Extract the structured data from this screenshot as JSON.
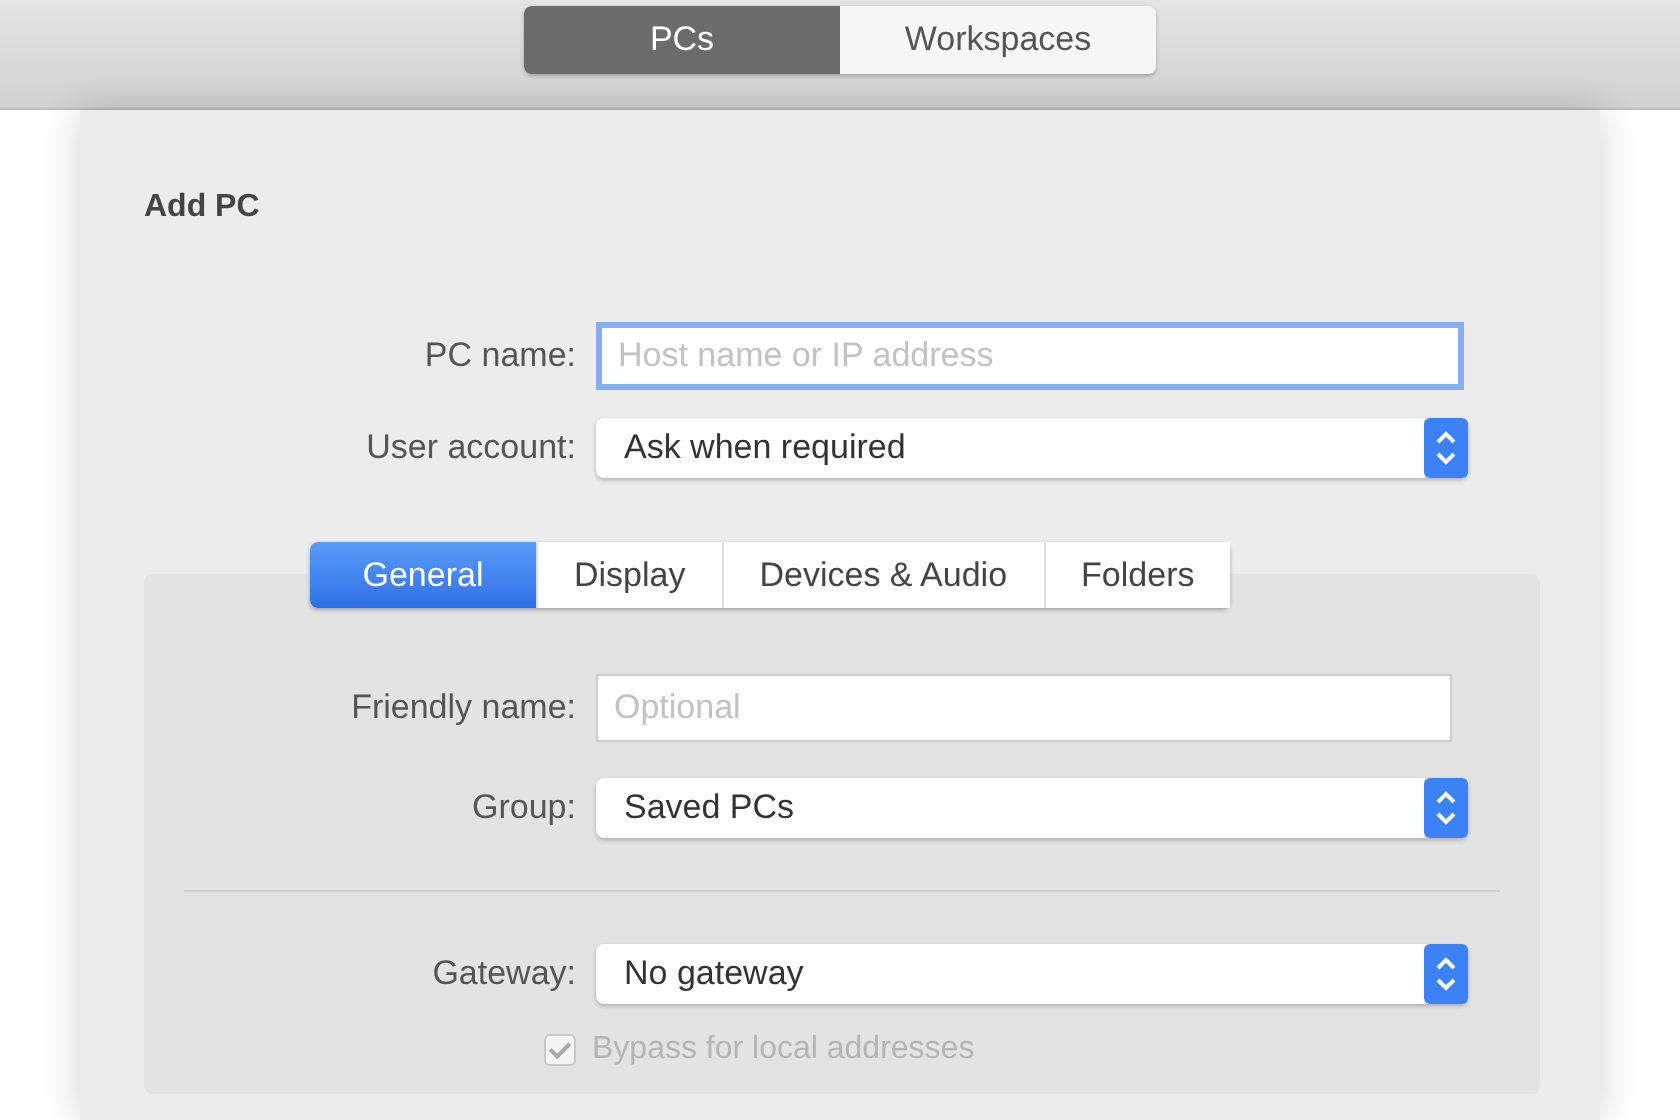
{
  "toolbar": {
    "segments": [
      {
        "label": "PCs",
        "selected": true
      },
      {
        "label": "Workspaces",
        "selected": false
      }
    ]
  },
  "sheet": {
    "title": "Add PC",
    "fields": [
      {
        "label": "PC name:",
        "kind": "text",
        "placeholder": "Host name or IP address",
        "focused": true
      },
      {
        "label": "User account:",
        "kind": "popup",
        "value": "Ask when required",
        "focused": false
      }
    ],
    "tabs": [
      {
        "label": "General",
        "selected": true
      },
      {
        "label": "Display",
        "selected": false
      },
      {
        "label": "Devices & Audio",
        "selected": false
      },
      {
        "label": "Folders",
        "selected": false
      }
    ],
    "general_fields": [
      {
        "label": "Friendly name:",
        "kind": "text",
        "placeholder": "Optional",
        "focused": false
      },
      {
        "label": "Group:",
        "kind": "popup",
        "value": "Saved PCs",
        "focused": false
      },
      {
        "kind": "separator"
      },
      {
        "label": "Gateway:",
        "kind": "popup",
        "value": "No gateway",
        "focused": false
      }
    ],
    "checkbox": {
      "label": "Bypass for local addresses",
      "checked": true,
      "disabled": true
    }
  }
}
